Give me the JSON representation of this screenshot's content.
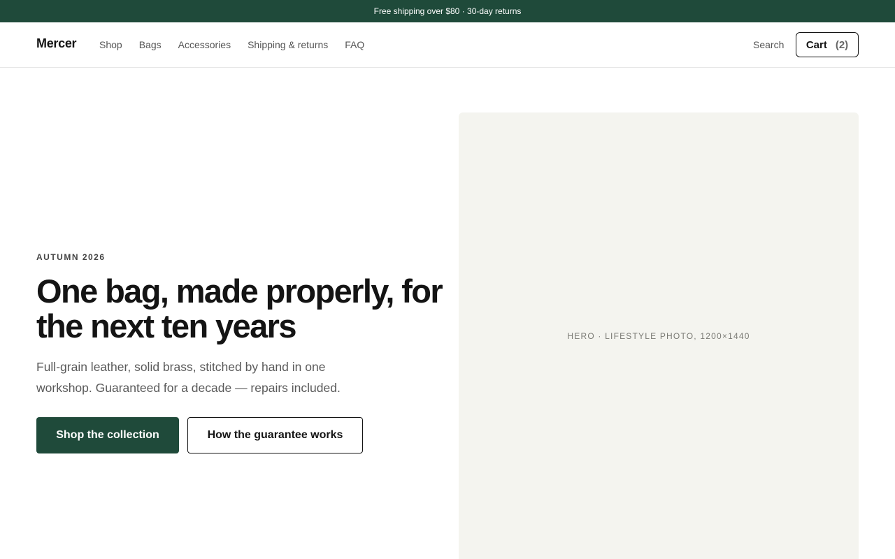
{
  "announcement": "Free shipping over $80 · 30-day returns",
  "header": {
    "logo": "Mercer",
    "nav": [
      "Shop",
      "Bags",
      "Accessories",
      "Shipping & returns",
      "FAQ"
    ],
    "search_label": "Search",
    "cart_label": "Cart",
    "cart_count": "(2)"
  },
  "hero": {
    "eyebrow": "AUTUMN 2026",
    "headline": "One bag, made properly, for the next ten years",
    "subcopy": "Full-grain leather, solid brass, stitched by hand in one workshop. Guaranteed for a decade — repairs included.",
    "primary_cta": "Shop the collection",
    "secondary_cta": "How the guarantee works",
    "image_caption": "HERO · LIFESTYLE PHOTO, 1200×1440"
  },
  "colors": {
    "brand": "#1f4a3a",
    "image_placeholder": "#f4f4ef",
    "text": "#141414"
  }
}
